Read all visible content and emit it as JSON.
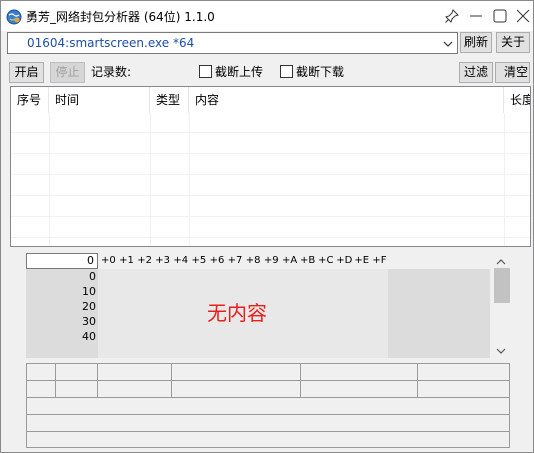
{
  "window": {
    "title": "勇芳_网络封包分析器 (64位) 1.1.0",
    "icons": [
      "app-globe-icon",
      "pin-icon",
      "minimize-icon",
      "maximize-icon",
      "close-icon"
    ]
  },
  "process_select": {
    "value": "01604:smartscreen.exe *64"
  },
  "toolbar": {
    "refresh_label": "刷新",
    "about_label": "关于",
    "start_label": "开启",
    "stop_label": "停止",
    "record_count_label": "记录数:",
    "cut_upload_label": "截断上传",
    "cut_download_label": "截断下载",
    "filter_label": "过滤",
    "clear_label": "清空",
    "cut_upload_checked": false,
    "cut_download_checked": false
  },
  "packet_list": {
    "columns": [
      "序号",
      "时间",
      "类型",
      "内容",
      "长度"
    ]
  },
  "hex_view": {
    "offset_value": "0",
    "column_headers": [
      "+0",
      "+1",
      "+2",
      "+3",
      "+4",
      "+5",
      "+6",
      "+7",
      "+8",
      "+9",
      "+A",
      "+B",
      "+C",
      "+D",
      "+E",
      "+F"
    ],
    "row_offsets": [
      "0",
      "10",
      "20",
      "30",
      "40"
    ],
    "empty_message": "无内容"
  },
  "colors": {
    "process_text": "#1e4ea8",
    "empty_message": "#e8201c",
    "window_bg": "#f0f0f0"
  }
}
